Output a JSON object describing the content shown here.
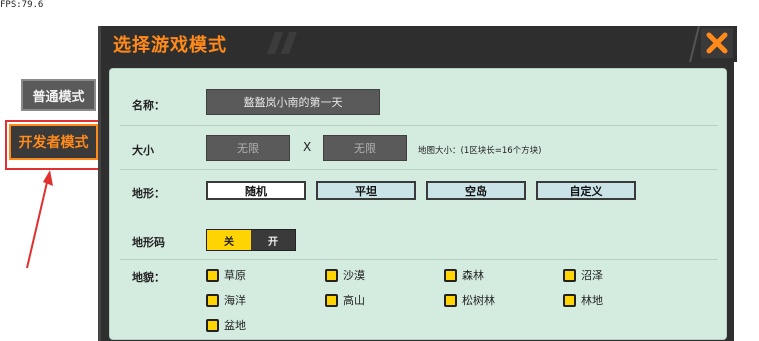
{
  "fps_label": "FPS:79.6",
  "side_tabs": {
    "normal": "普通模式",
    "developer": "开发者模式"
  },
  "panel": {
    "title": "选择游戏模式"
  },
  "form": {
    "name_label": "名称：",
    "name_value": "盩盩岚小南的第一天",
    "size_label": "大小",
    "size_w": "无限",
    "size_x": "X",
    "size_h": "无限",
    "size_hint": "地图大小：(1区块长=16个方块)",
    "terrain_label": "地形：",
    "terrain_options": [
      "随机",
      "平坦",
      "空岛",
      "自定义"
    ],
    "terrain_code_label": "地形码",
    "toggle_on": "关",
    "toggle_off": "开",
    "biome_label": "地貌：",
    "biomes": [
      "草原",
      "沙漠",
      "森林",
      "沼泽",
      "海洋",
      "高山",
      "松树林",
      "林地",
      "盆地"
    ]
  },
  "colors": {
    "accent": "#ff8a1a",
    "highlight_border": "#e03030",
    "content_bg": "#d4ebe0",
    "checkbox": "#ffd400"
  }
}
